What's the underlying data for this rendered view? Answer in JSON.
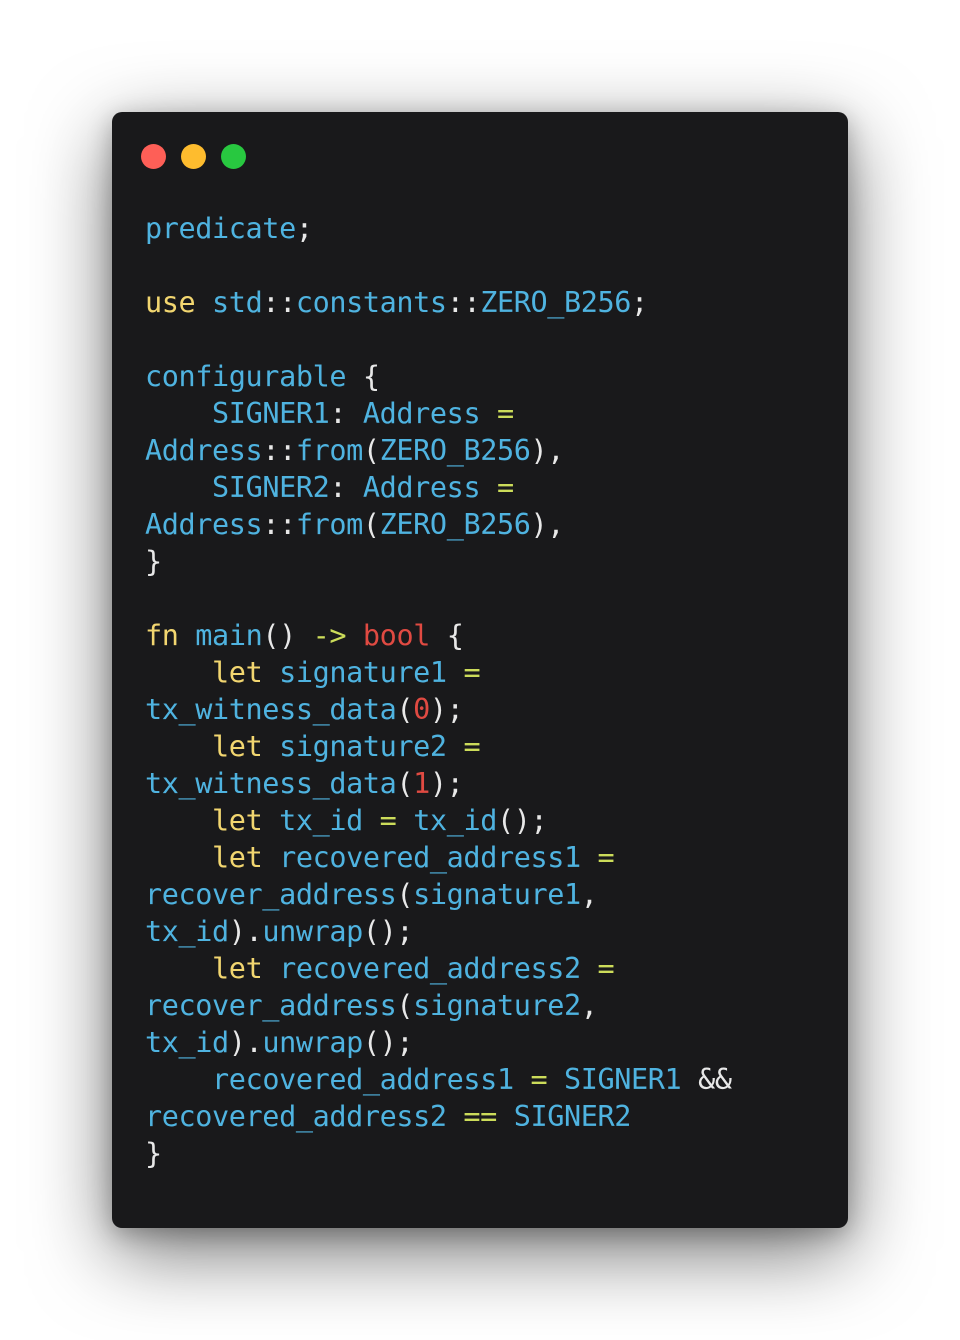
{
  "colors": {
    "background": "#ffffff",
    "window_background": "#19191b",
    "close_dot": "#fe5f57",
    "minimize_dot": "#febc2e",
    "maximize_dot": "#28c840",
    "keyword": "#f2d670",
    "identifier": "#4fb3e0",
    "type_and_number": "#e04a42",
    "operator": "#ccdc5a",
    "punctuation": "#e8e8e8"
  },
  "code_lines": [
    [
      [
        "id",
        "predicate"
      ],
      [
        "p",
        ";"
      ]
    ],
    [],
    [
      [
        "kw",
        "use"
      ],
      [
        "p",
        " "
      ],
      [
        "id",
        "std"
      ],
      [
        "p",
        "::"
      ],
      [
        "id",
        "constants"
      ],
      [
        "p",
        "::"
      ],
      [
        "id",
        "ZERO_B256"
      ],
      [
        "p",
        ";"
      ]
    ],
    [],
    [
      [
        "id",
        "configurable"
      ],
      [
        "p",
        " {"
      ]
    ],
    [
      [
        "p",
        "    "
      ],
      [
        "id",
        "SIGNER1"
      ],
      [
        "p",
        ": "
      ],
      [
        "id",
        "Address"
      ],
      [
        "p",
        " "
      ],
      [
        "op",
        "="
      ]
    ],
    [
      [
        "id",
        "Address"
      ],
      [
        "p",
        "::"
      ],
      [
        "id",
        "from"
      ],
      [
        "p",
        "("
      ],
      [
        "id",
        "ZERO_B256"
      ],
      [
        "p",
        "),"
      ]
    ],
    [
      [
        "p",
        "    "
      ],
      [
        "id",
        "SIGNER2"
      ],
      [
        "p",
        ": "
      ],
      [
        "id",
        "Address"
      ],
      [
        "p",
        " "
      ],
      [
        "op",
        "="
      ]
    ],
    [
      [
        "id",
        "Address"
      ],
      [
        "p",
        "::"
      ],
      [
        "id",
        "from"
      ],
      [
        "p",
        "("
      ],
      [
        "id",
        "ZERO_B256"
      ],
      [
        "p",
        "),"
      ]
    ],
    [
      [
        "p",
        "}"
      ]
    ],
    [],
    [
      [
        "kw",
        "fn"
      ],
      [
        "p",
        " "
      ],
      [
        "id",
        "main"
      ],
      [
        "p",
        "() "
      ],
      [
        "op",
        "->"
      ],
      [
        "p",
        " "
      ],
      [
        "type",
        "bool"
      ],
      [
        "p",
        " {"
      ]
    ],
    [
      [
        "p",
        "    "
      ],
      [
        "kw",
        "let"
      ],
      [
        "p",
        " "
      ],
      [
        "id",
        "signature1"
      ],
      [
        "p",
        " "
      ],
      [
        "op",
        "="
      ]
    ],
    [
      [
        "id",
        "tx_witness_data"
      ],
      [
        "p",
        "("
      ],
      [
        "num",
        "0"
      ],
      [
        "p",
        ");"
      ]
    ],
    [
      [
        "p",
        "    "
      ],
      [
        "kw",
        "let"
      ],
      [
        "p",
        " "
      ],
      [
        "id",
        "signature2"
      ],
      [
        "p",
        " "
      ],
      [
        "op",
        "="
      ]
    ],
    [
      [
        "id",
        "tx_witness_data"
      ],
      [
        "p",
        "("
      ],
      [
        "num",
        "1"
      ],
      [
        "p",
        ");"
      ]
    ],
    [
      [
        "p",
        "    "
      ],
      [
        "kw",
        "let"
      ],
      [
        "p",
        " "
      ],
      [
        "id",
        "tx_id"
      ],
      [
        "p",
        " "
      ],
      [
        "op",
        "="
      ],
      [
        "p",
        " "
      ],
      [
        "id",
        "tx_id"
      ],
      [
        "p",
        "();"
      ]
    ],
    [
      [
        "p",
        "    "
      ],
      [
        "kw",
        "let"
      ],
      [
        "p",
        " "
      ],
      [
        "id",
        "recovered_address1"
      ],
      [
        "p",
        " "
      ],
      [
        "op",
        "="
      ]
    ],
    [
      [
        "id",
        "recover_address"
      ],
      [
        "p",
        "("
      ],
      [
        "id",
        "signature1"
      ],
      [
        "p",
        ","
      ]
    ],
    [
      [
        "id",
        "tx_id"
      ],
      [
        "p",
        ")."
      ],
      [
        "id",
        "unwrap"
      ],
      [
        "p",
        "();"
      ]
    ],
    [
      [
        "p",
        "    "
      ],
      [
        "kw",
        "let"
      ],
      [
        "p",
        " "
      ],
      [
        "id",
        "recovered_address2"
      ],
      [
        "p",
        " "
      ],
      [
        "op",
        "="
      ]
    ],
    [
      [
        "id",
        "recover_address"
      ],
      [
        "p",
        "("
      ],
      [
        "id",
        "signature2"
      ],
      [
        "p",
        ","
      ]
    ],
    [
      [
        "id",
        "tx_id"
      ],
      [
        "p",
        ")."
      ],
      [
        "id",
        "unwrap"
      ],
      [
        "p",
        "();"
      ]
    ],
    [
      [
        "p",
        "    "
      ],
      [
        "id",
        "recovered_address1"
      ],
      [
        "p",
        " "
      ],
      [
        "op",
        "="
      ],
      [
        "p",
        " "
      ],
      [
        "id",
        "SIGNER1"
      ],
      [
        "p",
        " &&"
      ]
    ],
    [
      [
        "id",
        "recovered_address2"
      ],
      [
        "p",
        " "
      ],
      [
        "op",
        "=="
      ],
      [
        "p",
        " "
      ],
      [
        "id",
        "SIGNER2"
      ]
    ],
    [
      [
        "p",
        "}"
      ]
    ]
  ]
}
